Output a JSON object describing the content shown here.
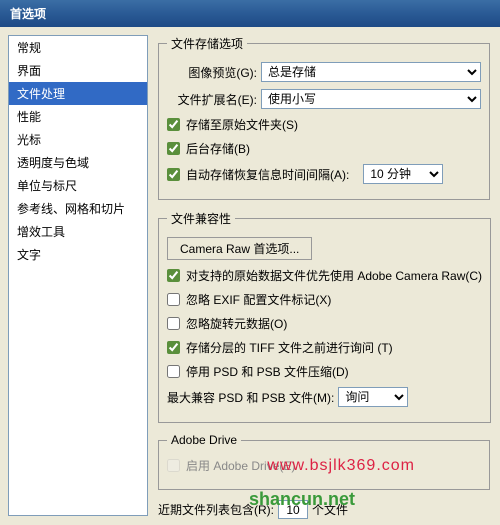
{
  "title": "首选项",
  "sidebar": {
    "items": [
      {
        "label": "常规"
      },
      {
        "label": "界面"
      },
      {
        "label": "文件处理"
      },
      {
        "label": "性能"
      },
      {
        "label": "光标"
      },
      {
        "label": "透明度与色域"
      },
      {
        "label": "单位与标尺"
      },
      {
        "label": "参考线、网格和切片"
      },
      {
        "label": "增效工具"
      },
      {
        "label": "文字"
      }
    ],
    "selected_index": 2
  },
  "file_save": {
    "legend": "文件存储选项",
    "preview_label": "图像预览(G):",
    "preview_value": "总是存储",
    "ext_label": "文件扩展名(E):",
    "ext_value": "使用小写",
    "save_original": {
      "label": "存储至原始文件夹(S)",
      "checked": true
    },
    "bg_save": {
      "label": "后台存储(B)",
      "checked": true
    },
    "auto_save": {
      "label": "自动存储恢复信息时间间隔(A):",
      "checked": true,
      "value": "10 分钟"
    }
  },
  "file_compat": {
    "legend": "文件兼容性",
    "camera_raw_btn": "Camera Raw 首选项...",
    "prefer_acr": {
      "label": "对支持的原始数据文件优先使用 Adobe Camera Raw(C)",
      "checked": true
    },
    "ignore_exif": {
      "label": "忽略 EXIF 配置文件标记(X)",
      "checked": false
    },
    "ignore_rot": {
      "label": "忽略旋转元数据(O)",
      "checked": false
    },
    "ask_tiff": {
      "label": "存储分层的 TIFF 文件之前进行询问 (T)",
      "checked": true
    },
    "disable_comp": {
      "label": "停用 PSD 和 PSB 文件压缩(D)",
      "checked": false
    },
    "max_compat_label": "最大兼容 PSD 和 PSB 文件(M):",
    "max_compat_value": "询问"
  },
  "adobe_drive": {
    "legend": "Adobe Drive",
    "enable": {
      "label": "启用 Adobe Drive(E)",
      "checked": false
    }
  },
  "recent": {
    "label_pre": "近期文件列表包含(R):",
    "value": "10",
    "label_post": "个文件"
  },
  "watermark1": "www.bsjlk369.com",
  "watermark2": "shancun.net"
}
